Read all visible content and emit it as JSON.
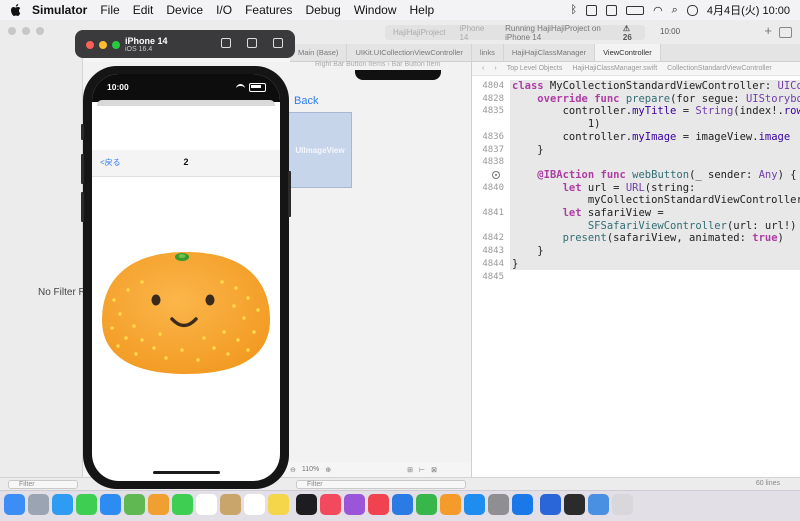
{
  "menubar": {
    "items": [
      "Simulator",
      "File",
      "Edit",
      "Device",
      "I/O",
      "Features",
      "Debug",
      "Window",
      "Help"
    ],
    "clock": "4月4日(火) 10:00"
  },
  "xcode": {
    "scheme_blurred": "HajiHajiProject",
    "device_blurred": "iPhone 14",
    "status": "Running HajiHajiProject on iPhone 14",
    "warnings": "26",
    "toolbar_time": "10:00",
    "tabs": [
      "Main (Base)",
      "UIKit.UICollectionViewController",
      "links",
      "HajiHajiClassManager",
      "ViewController"
    ],
    "editor_breadcrumb": [
      "Top Level Objects",
      "HajiHajiClassManager.swift",
      "CollectionStandardViewController"
    ],
    "canvas_breadcrumb": [
      "Right Bar Button Items",
      "Bar Button Item"
    ],
    "no_filter": "No Filter Re",
    "canvas_back": "Back",
    "canvas_image": "UIImageView",
    "zoom": "110%",
    "filter_left": "Filter",
    "filter_mid": "Filter",
    "line_count": "60 lines",
    "code_lines": [
      {
        "n": "4804",
        "t": "class MyCollectionStandardViewController: UIColl"
      },
      {
        "n": "4828",
        "t": "    override func prepare(for segue: UIStoryboar"
      },
      {
        "n": "4835",
        "t": "        controller.myTitle = String(index!.row +"
      },
      {
        "n": "",
        "t": "            1)"
      },
      {
        "n": "4836",
        "t": "        controller.myImage = imageView.image"
      },
      {
        "n": "4837",
        "t": "    }"
      },
      {
        "n": "4838",
        "t": ""
      },
      {
        "n": "",
        "t": "    @IBAction func webButton(_ sender: Any) {"
      },
      {
        "n": "4840",
        "t": "        let url = URL(string:"
      },
      {
        "n": "",
        "t": "            myCollectionStandardViewController)"
      },
      {
        "n": "4841",
        "t": "        let safariView ="
      },
      {
        "n": "",
        "t": "            SFSafariViewController(url: url!)"
      },
      {
        "n": "4842",
        "t": "        present(safariView, animated: true)"
      },
      {
        "n": "4843",
        "t": "    }"
      },
      {
        "n": "4844",
        "t": "}"
      },
      {
        "n": "4845",
        "t": ""
      }
    ]
  },
  "simulator": {
    "device": "iPhone 14",
    "os": "iOS 16.4",
    "status_time": "10:00",
    "nav_back": "<戻る",
    "nav_title": "2",
    "image": "smiling-mandarin-orange"
  },
  "dock": {
    "apps": [
      "finder",
      "launchpad",
      "safari",
      "messages",
      "mail",
      "maps",
      "photos",
      "facetime",
      "calendar",
      "contacts",
      "reminders",
      "notes",
      "tv",
      "music",
      "podcasts",
      "news",
      "keynote",
      "numbers",
      "pages",
      "appstore",
      "settings",
      "xcode",
      "simulator",
      "terminal",
      "preview",
      "trash"
    ]
  },
  "colors": {
    "accent": "#2f7cf6",
    "keyword": "#ad3da4",
    "orange": "#f7a82c"
  }
}
